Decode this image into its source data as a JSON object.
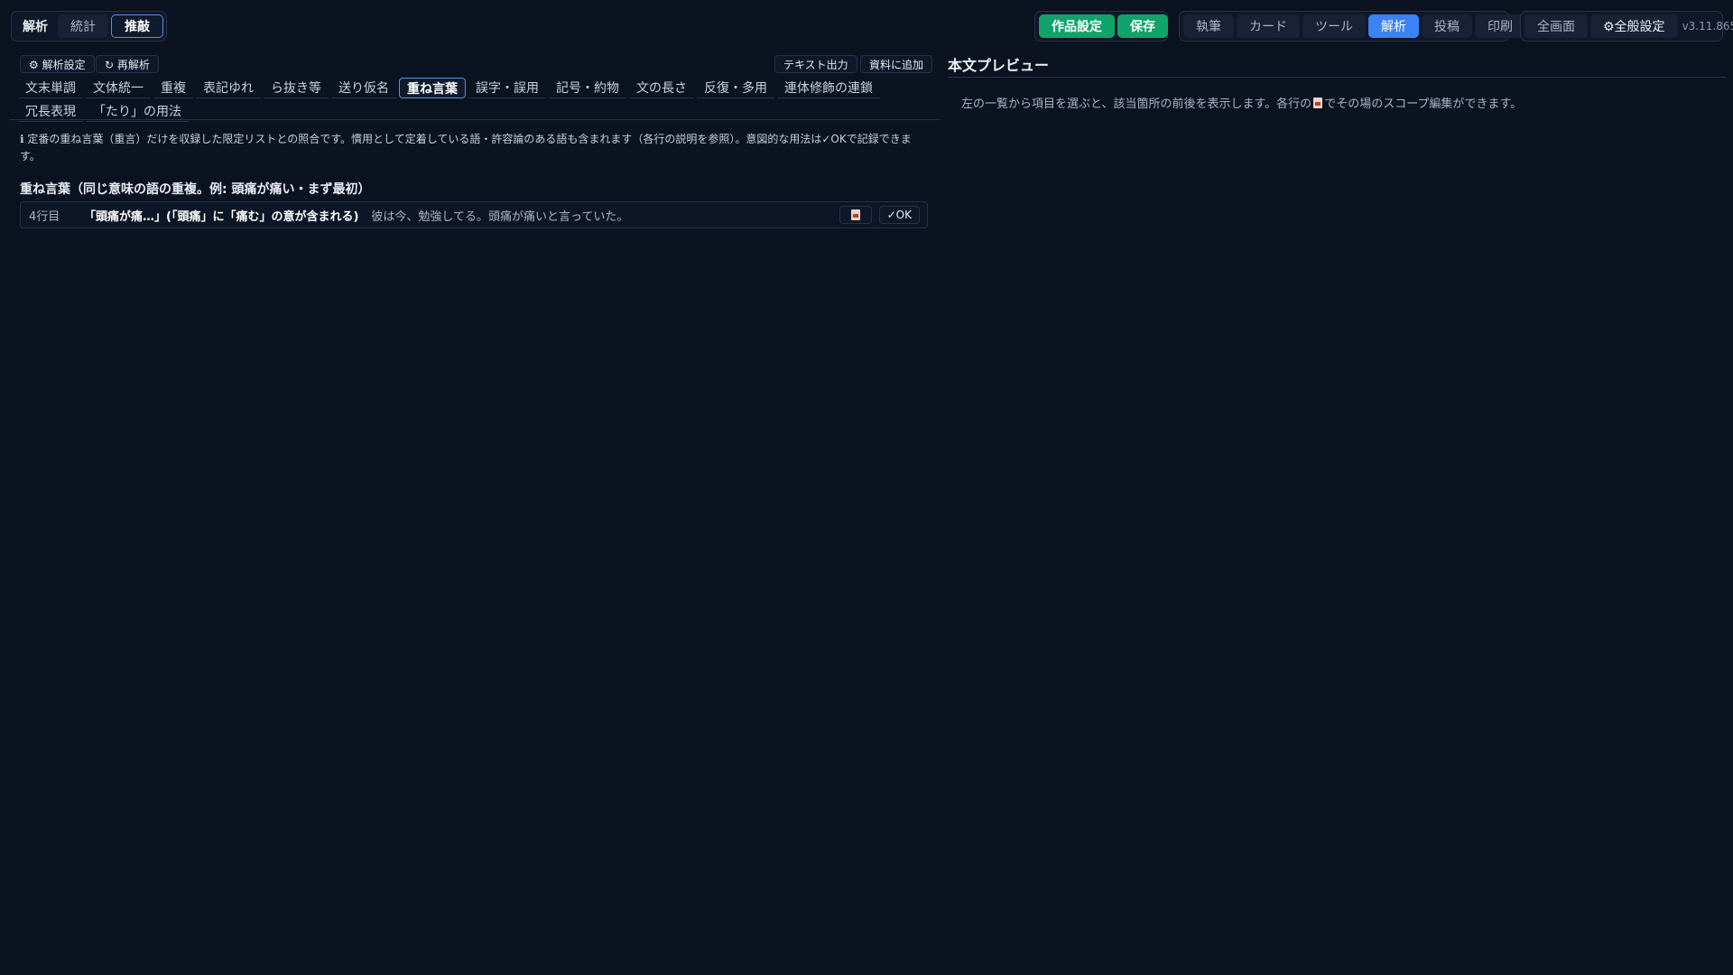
{
  "top_left_modes": [
    "解析",
    "統計",
    "推敲"
  ],
  "project": {
    "settings": "作品設定",
    "save": "保存"
  },
  "views": [
    "執筆",
    "カード",
    "ツール",
    "解析",
    "投稿",
    "印刷"
  ],
  "global": {
    "fullscreen": "全画面",
    "settings": "⚙全般設定",
    "version": "v3.11.865"
  },
  "toolbar": {
    "analysis_settings": "⚙ 解析設定",
    "reanalyze": "↻ 再解析",
    "text_export": "テキスト出力",
    "add_material": "資料に追加"
  },
  "tabs_row1": [
    "文末単調",
    "文体統一",
    "重複",
    "表記ゆれ",
    "ら抜き等",
    "送り仮名",
    "重ね言葉",
    "誤字・誤用",
    "記号・約物",
    "文の長さ",
    "反復・多用",
    "連体修飾の連鎖"
  ],
  "tabs_row2": [
    "冗長表現",
    "「たり」の用法"
  ],
  "active_tab": "重ね言葉",
  "info_text": "ℹ 定番の重ね言葉（重言）だけを収録した限定リストとの照合です。慣用として定着している語・許容論のある語も含まれます（各行の説明を参照）。意図的な用法は✓OKで記録できます。",
  "section_title": "重ね言葉（同じ意味の語の重複。例: 頭痛が痛い・まず最初）",
  "result": {
    "line": "4行目",
    "term": "「頭痛が痛…」(「頭痛」に「痛む」の意が含まれる)",
    "context": "彼は今、勉強してる。頭痛が痛いと言っていた。",
    "ok_label": "✓OK"
  },
  "preview": {
    "title": "本文プレビュー",
    "text_before": "左の一覧から項目を選ぶと、該当箇所の前後を表示します。各行の",
    "text_after": "でその場のスコープ編集ができます。"
  }
}
